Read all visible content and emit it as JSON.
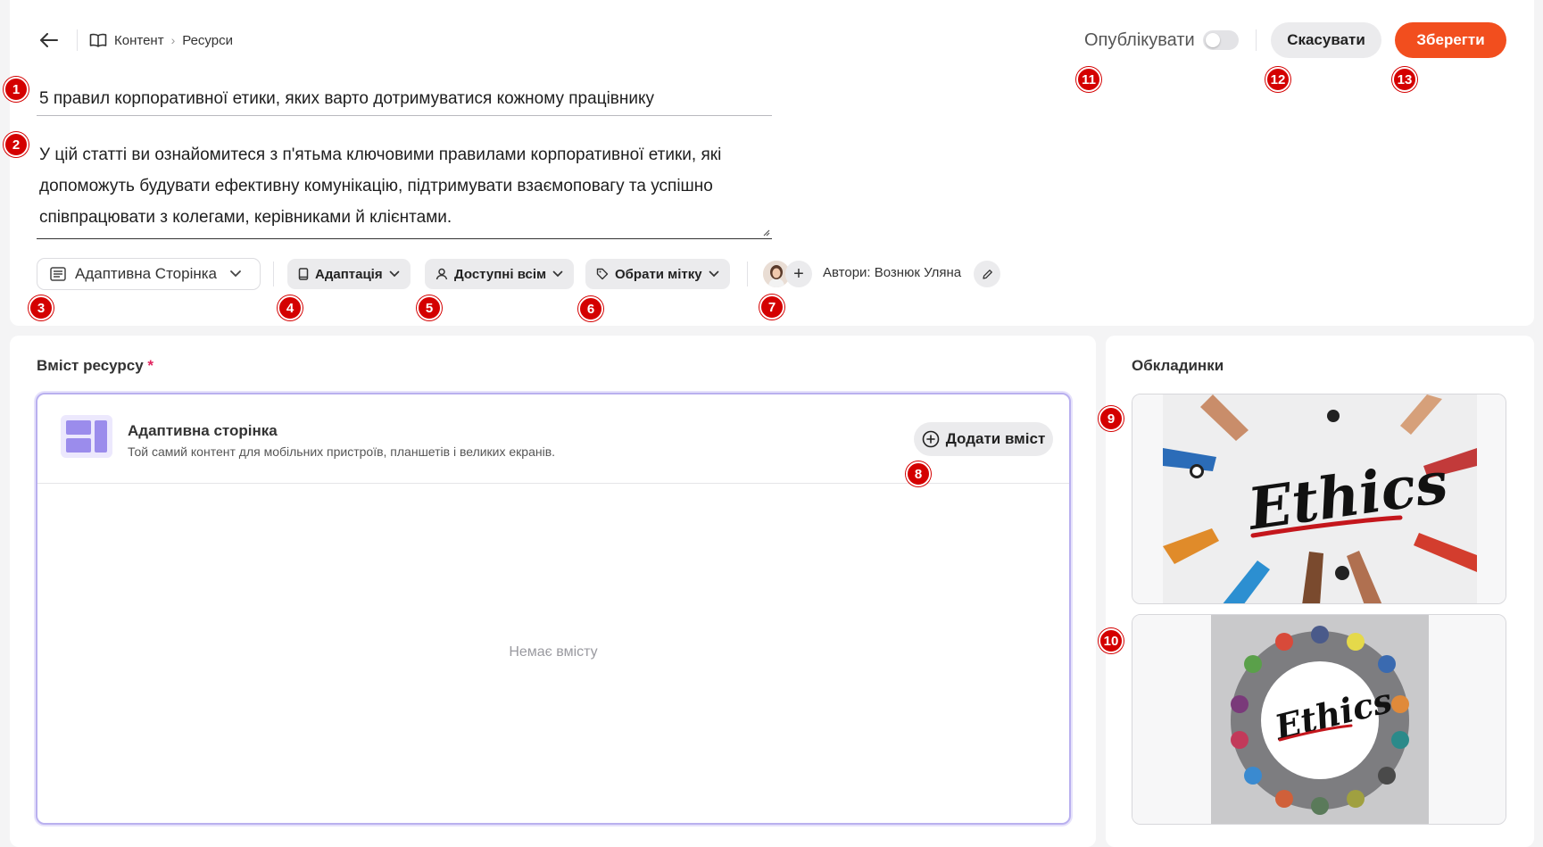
{
  "breadcrumb": {
    "items": [
      "Контент",
      "Ресурси"
    ]
  },
  "resource": {
    "title": "5 правил корпоративної етики, яких варто дотримуватися кожному працівнику",
    "description": "У цій статті ви ознайомитеся з п'ятьма ключовими правилами корпоративної етики, які допоможуть будувати ефективну комунікацію, підтримувати взаємоповагу та успішно співпрацювати з колегами, керівниками й клієнтами."
  },
  "toolbar": {
    "type_select": "Адаптивна Сторінка",
    "adaptation": "Адаптація",
    "access": "Доступні всім",
    "tag": "Обрати мітку",
    "authors": "Автори: Вознюк Уляна"
  },
  "header_actions": {
    "publish_label": "Опублікувати",
    "publish_on": false,
    "cancel": "Скасувати",
    "save": "Зберегти"
  },
  "content": {
    "label": "Вміст ресурсу",
    "required_mark": "*",
    "page_type_title": "Адаптивна сторінка",
    "page_type_sub": "Той самий контент для мобільних пристроїв, планшетів і великих екранів.",
    "add_button": "Додати вміст",
    "empty": "Немає вмісту"
  },
  "covers": {
    "label": "Обкладинки",
    "items": [
      {
        "word": "Ethics",
        "style": "hands-on-table"
      },
      {
        "word": "Ethics",
        "style": "people-circle"
      }
    ]
  },
  "badges": [
    "1",
    "2",
    "3",
    "4",
    "5",
    "6",
    "7",
    "8",
    "9",
    "10",
    "11",
    "12",
    "13"
  ],
  "colors": {
    "accent": "#f24e1e",
    "badge": "#d40000",
    "focus": "#b9b0ef"
  }
}
